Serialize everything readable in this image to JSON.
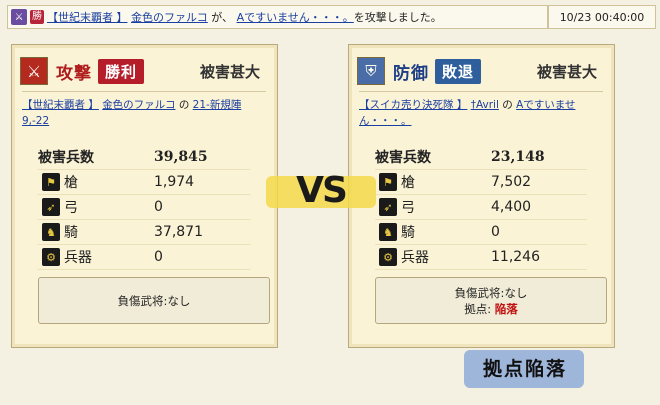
{
  "top": {
    "badge": "勝",
    "attacker_alliance": "【世紀末覇者 】",
    "attacker_name": "金色のファルコ",
    "ga": "が、",
    "target_name": "Aですいません・・・。",
    "suffix": "を攻撃しました。",
    "time": "10/23 00:40:00"
  },
  "attack": {
    "role": "攻撃",
    "result": "勝利",
    "damage_grade": "被害甚大",
    "alliance": "【世紀末覇者 】",
    "name": "金色のファルコ",
    "no": "の",
    "base": "21-新規陣9,-22",
    "total_label": "被害兵数",
    "total": "39,845",
    "rows": [
      {
        "icon": "spear-icon",
        "label": "槍",
        "value": "1,974"
      },
      {
        "icon": "bow-icon",
        "label": "弓",
        "value": "0"
      },
      {
        "icon": "horse-icon",
        "label": "騎",
        "value": "37,871"
      },
      {
        "icon": "weapon-icon",
        "label": "兵器",
        "value": "0"
      }
    ],
    "casualty_label": "負傷武将:",
    "casualty_value": "なし"
  },
  "defense": {
    "role": "防御",
    "result": "敗退",
    "damage_grade": "被害甚大",
    "alliance": "【スイカ売り決死隊 】",
    "name": "†Avril",
    "no": "の",
    "base": "Aですいません・・・。",
    "total_label": "被害兵数",
    "total": "23,148",
    "rows": [
      {
        "icon": "spear-icon",
        "label": "槍",
        "value": "7,502"
      },
      {
        "icon": "bow-icon",
        "label": "弓",
        "value": "4,400"
      },
      {
        "icon": "horse-icon",
        "label": "騎",
        "value": "0"
      },
      {
        "icon": "weapon-icon",
        "label": "兵器",
        "value": "11,246"
      }
    ],
    "casualty_label": "負傷武将:",
    "casualty_value": "なし",
    "base_label": "拠点:",
    "base_status": "陥落"
  },
  "vs": "VS",
  "banner": "拠点陥落",
  "colors": {
    "win": "#b51d2a",
    "lose": "#2f5e9c",
    "fall": "#c01010"
  }
}
